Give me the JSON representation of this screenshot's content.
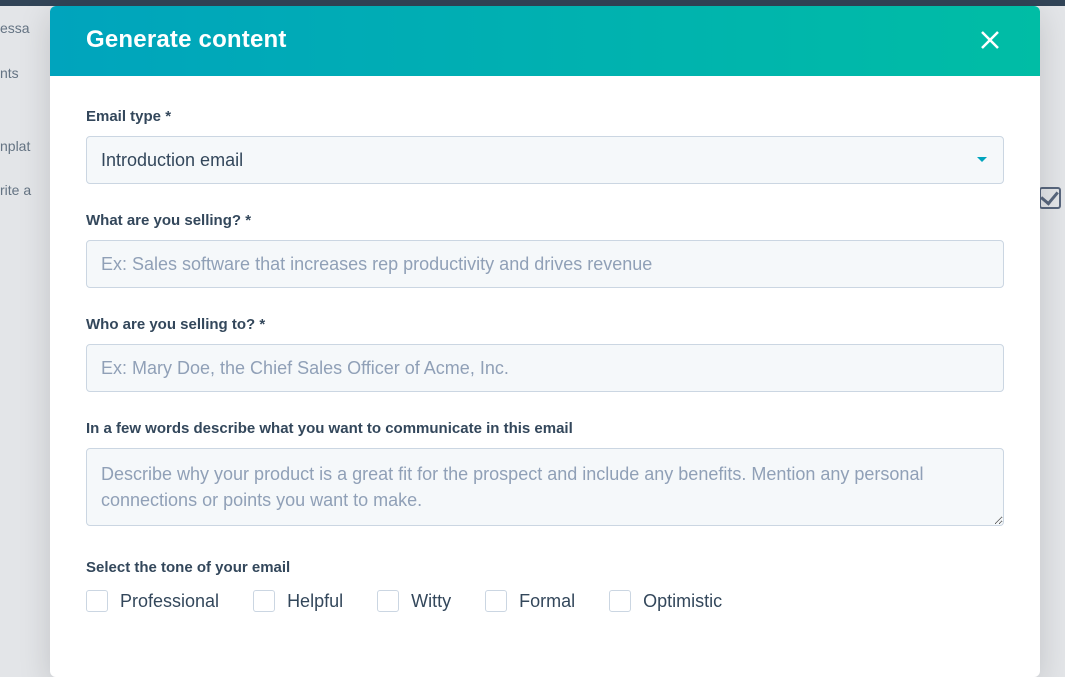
{
  "background": {
    "sidebar_fragments": [
      "essa",
      "nts",
      "",
      "nplat",
      "rite a"
    ]
  },
  "modal": {
    "title": "Generate content",
    "fields": {
      "email_type": {
        "label": "Email type *",
        "value": "Introduction email"
      },
      "selling_what": {
        "label": "What are you selling? *",
        "placeholder": "Ex: Sales software that increases rep productivity and drives revenue",
        "value": ""
      },
      "selling_to": {
        "label": "Who are you selling to? *",
        "placeholder": "Ex: Mary Doe, the Chief Sales Officer of Acme, Inc.",
        "value": ""
      },
      "describe": {
        "label": "In a few words describe what you want to communicate in this email",
        "placeholder": "Describe why your product is a great fit for the prospect and include any benefits. Mention any personal connections or points you want to make.",
        "value": ""
      },
      "tone": {
        "label": "Select the tone of your email",
        "options": [
          "Professional",
          "Helpful",
          "Witty",
          "Formal",
          "Optimistic"
        ]
      }
    }
  }
}
